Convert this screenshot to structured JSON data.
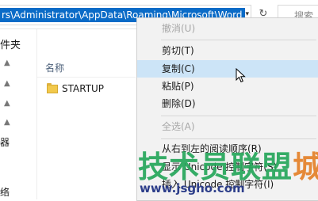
{
  "address_bar": {
    "path": "rs\\Administrator\\AppData\\Roaming\\Microsoft\\Word",
    "search_placeholder": "搜索"
  },
  "nav_pane": {
    "title": "件夹",
    "bottom_text_1": "器",
    "bottom_text_2": "络"
  },
  "file_list": {
    "column_name": "名称",
    "items": [
      {
        "name": "STARTUP"
      }
    ]
  },
  "context_menu": {
    "items": [
      {
        "label": "撤消(U)",
        "state": "disabled"
      },
      {
        "label": "剪切(T)",
        "state": "normal"
      },
      {
        "label": "复制(C)",
        "state": "hover"
      },
      {
        "label": "粘贴(P)",
        "state": "normal"
      },
      {
        "label": "删除(D)",
        "state": "normal"
      },
      {
        "label": "全选(A)",
        "state": "disabled"
      },
      {
        "label": "从右到左的阅读顺序(R)",
        "state": "normal"
      },
      {
        "label": "显示 Unicode 控制字符(S)",
        "state": "normal"
      },
      {
        "label": "插入 Unicode 控制字符(I)",
        "state": "normal"
      }
    ]
  },
  "watermark": {
    "brand": "技术员联盟",
    "suffix": "城",
    "url": "www.jsgho.com"
  },
  "colors": {
    "selection": "#0a6bc7",
    "menu_hover": "#cce4f7",
    "watermark_green": "#27a75c",
    "watermark_orange": "#e5822a"
  }
}
